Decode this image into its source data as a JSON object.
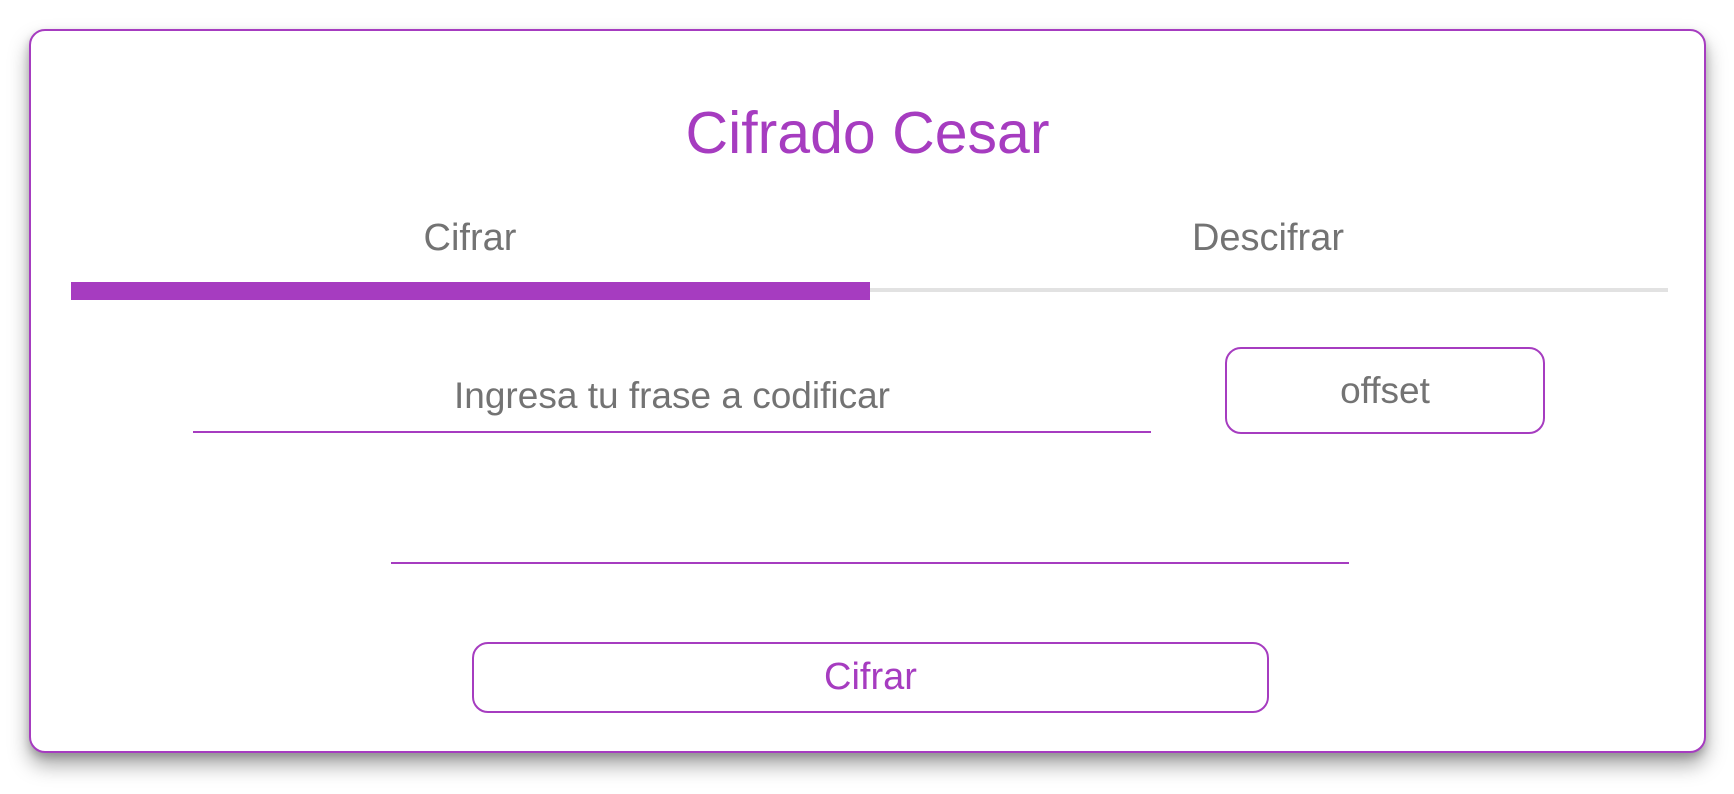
{
  "app": {
    "title": "Cifrado Cesar"
  },
  "tabs": [
    {
      "label": "Cifrar",
      "active": true
    },
    {
      "label": "Descifrar",
      "active": false
    }
  ],
  "form": {
    "phrase_placeholder": "Ingresa tu frase a codificar",
    "phrase_value": "",
    "offset_placeholder": "offset",
    "offset_value": "",
    "result_value": "",
    "submit_label": "Cifrar"
  },
  "colors": {
    "accent": "#a63cc0",
    "text_muted": "#737373",
    "tab_track": "#e2e2e2",
    "background": "#ffffff"
  }
}
